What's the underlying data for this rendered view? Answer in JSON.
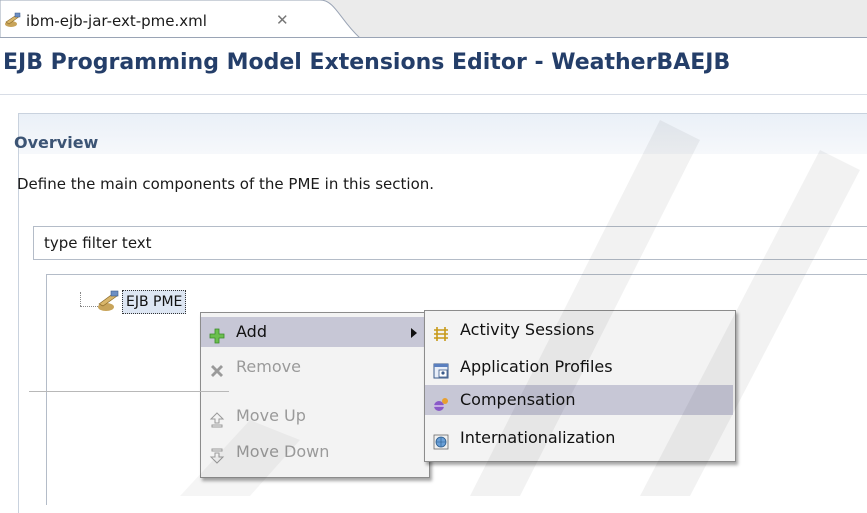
{
  "tab": {
    "label": "ibm-ejb-jar-ext-pme.xml",
    "close_glyph": "✕",
    "icon": "pme-editor-icon"
  },
  "editor": {
    "title": "EJB Programming Model Extensions Editor - WeatherBAEJB"
  },
  "section": {
    "title": "Overview",
    "description": "Define the main components of the PME in this section."
  },
  "filter": {
    "value": "type filter text"
  },
  "tree": {
    "root": {
      "label": "EJB PME",
      "icon": "pme-node-icon"
    }
  },
  "context_menu": {
    "items": [
      {
        "label": "Add",
        "icon": "add-icon",
        "enabled": true,
        "has_submenu": true
      },
      {
        "label": "Remove",
        "icon": "remove-icon",
        "enabled": false
      },
      {
        "label": "Move Up",
        "icon": "move-up-icon",
        "enabled": false
      },
      {
        "label": "Move Down",
        "icon": "move-down-icon",
        "enabled": false
      }
    ]
  },
  "submenu": {
    "items": [
      {
        "label": "Activity Sessions",
        "icon": "activity-sessions-icon"
      },
      {
        "label": "Application Profiles",
        "icon": "application-profiles-icon"
      },
      {
        "label": "Compensation",
        "icon": "compensation-icon",
        "highlighted": true
      },
      {
        "label": "Internationalization",
        "icon": "internationalization-icon"
      }
    ]
  },
  "colors": {
    "title_text": "#243e69",
    "section_title": "#3c5474",
    "menu_highlight": "#c7c7d6",
    "disabled_text": "#9a9a9a"
  }
}
